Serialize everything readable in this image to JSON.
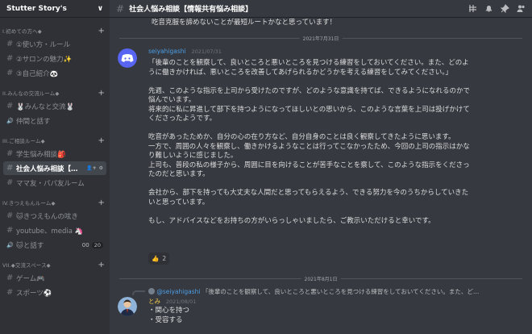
{
  "server": {
    "name": "Stutter Story's",
    "chevron": "∨"
  },
  "categories": [
    {
      "label": "I.初めての方へ◆",
      "channels": [
        {
          "label": "①使い方・ルール"
        },
        {
          "label": "②サロンの魅力✨"
        },
        {
          "label": "③自己紹介🐼"
        }
      ]
    },
    {
      "label": "II.みんなの交流ルーム◆",
      "channels": [
        {
          "label": "🐰みんなと交流🐰"
        },
        {
          "label": "仲間と話す"
        }
      ]
    },
    {
      "label": "III.ご相談ルーム◆",
      "channels": [
        {
          "label": "学生悩み相談🎒"
        },
        {
          "label": "社会人悩み相談【…"
        },
        {
          "label": "ママ友・パパ友ルーム"
        }
      ]
    },
    {
      "label": "IV.きつえもんルーム◆",
      "channels": [
        {
          "label": "🐱きつえもんの呟き"
        },
        {
          "label": "youtube、media 🦄"
        },
        {
          "label": "🐱と話す",
          "count1": "00",
          "count2": "20"
        }
      ]
    },
    {
      "label": "VII.◆交流スペース◆",
      "channels": [
        {
          "label": "ゲーム🎮"
        },
        {
          "label": "スポーツ⚽"
        }
      ]
    }
  ],
  "topbar": {
    "title": "社会人悩み相談【情報共有悩み相談】"
  },
  "feed": {
    "cut_line": "吃音克服を諦めないことが最短ルートかなと思っています！",
    "date1": "2021年7月31日",
    "msg1": {
      "author": "seiyahigashi",
      "time": "2021/07/31",
      "lines": [
        "「後輩のことを観察して、良いところと悪いところを見つける練習をしておいてください。また、どのよ",
        "うに働きかければ、悪いところを改善してあげられるかどうかを考える練習をしてみてください。」",
        "",
        "先週、このような指示を上司から受けたのですが、どのような意識を持てば、できるようになれるのかで",
        "悩んでいます。",
        "将来的に私に昇進して部下を持つようになってほしいとの思いから、このような言葉を上司は投げかけて",
        "くださったようです。",
        "",
        "吃音があったためか、自分の心の在り方など、自分自身のことは良く観察してきたように思います。",
        "一方で、周囲の人々を観察し、働きかけるようなことは行ってこなかったため、今回の上司の指示はかな",
        "り難しいように感じました。",
        "上司も、普段の私の様子から、周囲に目を向けることが苦手なことを察して、このような指示をくださっ",
        "たのだと思います。",
        "",
        "会社から、部下を持っても大丈夫な人間だと思ってもらえるよう、できる努力を今のうちからしていきた",
        "いと思っています。",
        "",
        "もし、アドバイスなどをお持ちの方がいらっしゃいましたら、ご教示いただけると幸いです。"
      ],
      "reaction": {
        "emoji": "👍",
        "count": "2"
      }
    },
    "date2": "2021年8月1日",
    "msg2": {
      "reply_author": "@seiyahigashi",
      "reply_text": "「後輩のことを観察して、良いところと悪いところを見つける練習をしておいてください。また、ど…",
      "author": "とみ",
      "time": "2021/08/01",
      "lines": [
        "・関心を持つ",
        "・受容する"
      ]
    }
  },
  "colors": {
    "author1": "#4d9ee6",
    "author2": "#f2c94c",
    "bg": "#36393f",
    "sidebar": "#2f3136"
  }
}
